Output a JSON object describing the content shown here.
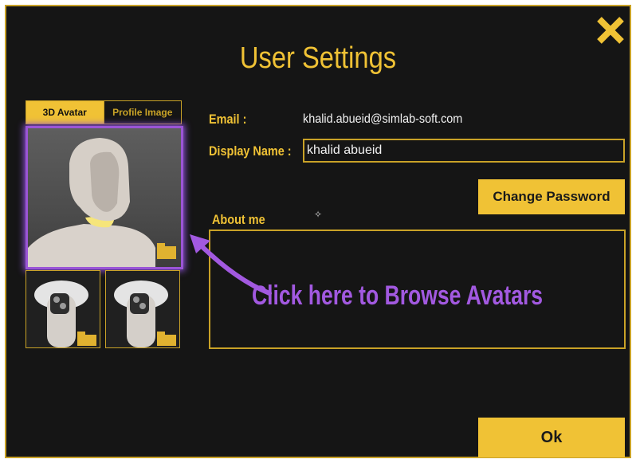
{
  "dialog": {
    "title": "User Settings"
  },
  "avatar_panel": {
    "tabs": [
      {
        "label": "3D Avatar",
        "active": true
      },
      {
        "label": "Profile Image",
        "active": false
      }
    ]
  },
  "form": {
    "email_label": "Email :",
    "email_value": "khalid.abueid@simlab-soft.com",
    "display_name_label": "Display Name :",
    "display_name_value": "khalid abueid",
    "change_password_label": "Change Password",
    "about_label": "About me",
    "about_value": ""
  },
  "annotation": {
    "text": "Click here to Browse Avatars"
  },
  "footer": {
    "ok_label": "Ok"
  },
  "colors": {
    "accent": "#f0c235",
    "background": "#151515",
    "highlight": "#9b55d6"
  },
  "icons": [
    "close-icon",
    "folder-icon",
    "arrow-icon",
    "sparkle-icon"
  ]
}
